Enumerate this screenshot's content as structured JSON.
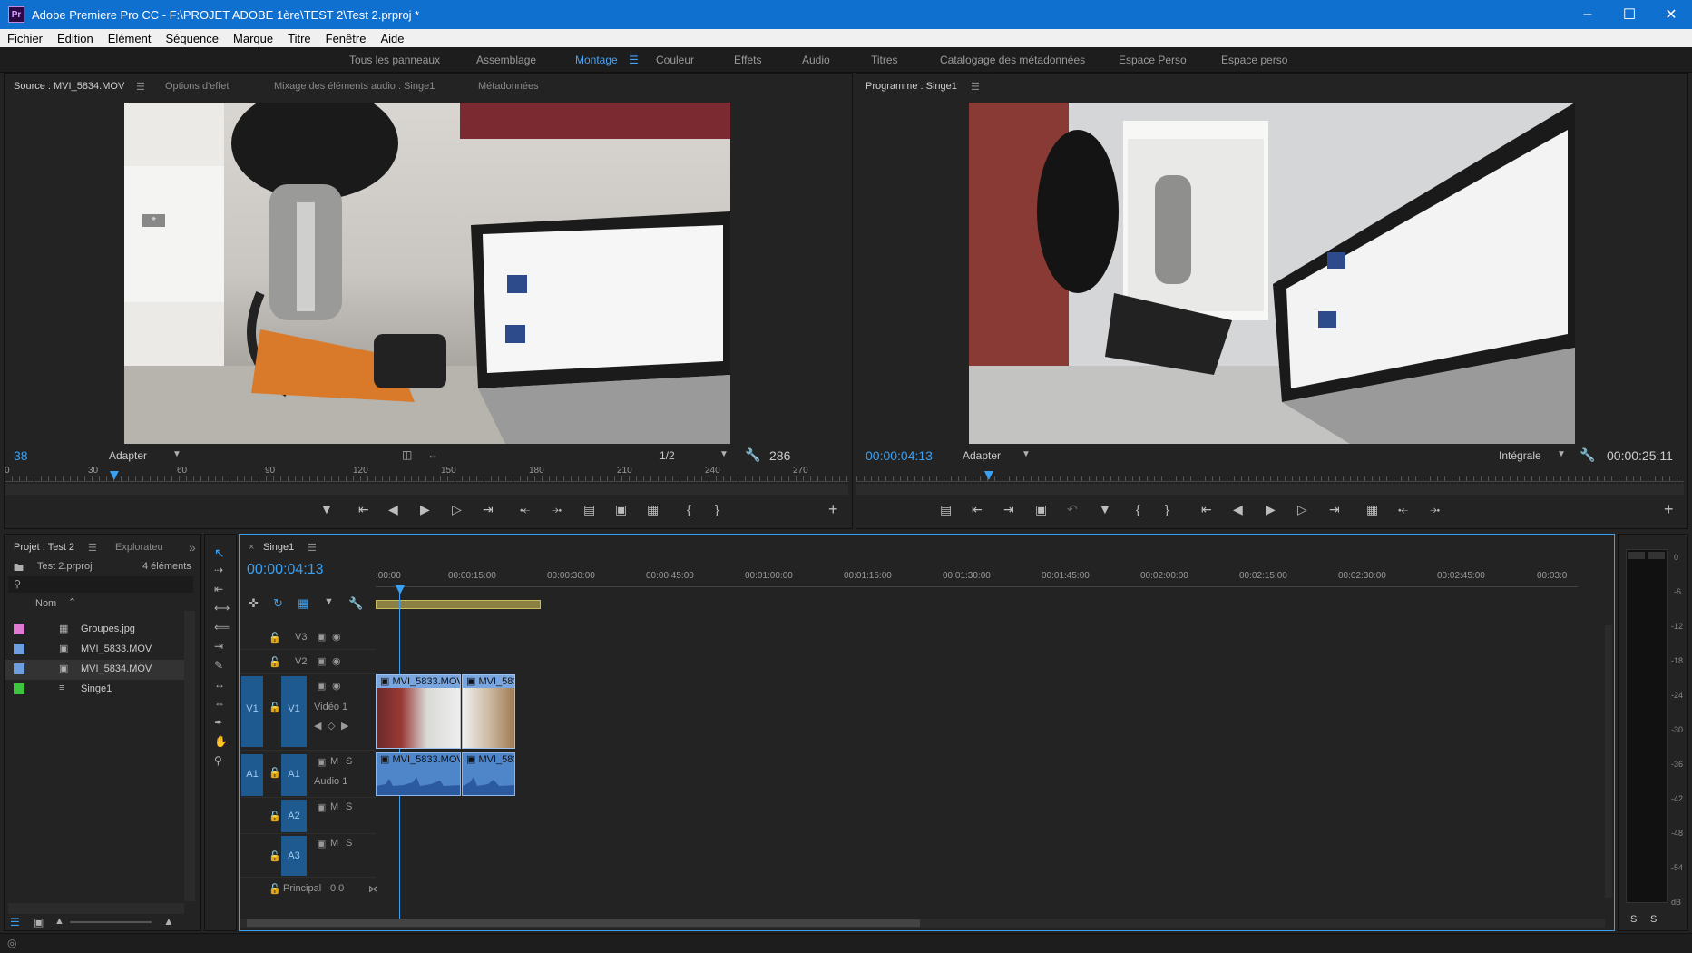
{
  "window": {
    "title": "Adobe Premiere Pro CC - F:\\PROJET ADOBE 1ère\\TEST 2\\Test 2.prproj *",
    "logo": "Pr"
  },
  "menu": [
    "Fichier",
    "Edition",
    "Elément",
    "Séquence",
    "Marque",
    "Titre",
    "Fenêtre",
    "Aide"
  ],
  "workspaces": [
    "Tous les panneaux",
    "Assemblage",
    "Montage",
    "Couleur",
    "Effets",
    "Audio",
    "Titres",
    "Catalogage des métadonnées",
    "Espace Perso",
    "Espace perso"
  ],
  "active_workspace": "Montage",
  "source": {
    "tabs": [
      "Source : MVI_5834.MOV",
      "Options d'effet",
      "Mixage des éléments audio : Singe1",
      "Métadonnées"
    ],
    "frame": "38",
    "fit": "Adapter",
    "quality": "1/2",
    "duration": "286",
    "ruler_ticks": [
      "0",
      "30",
      "60",
      "90",
      "120",
      "150",
      "180",
      "210",
      "240",
      "270"
    ],
    "playhead_fraction": 0.13
  },
  "program": {
    "tab": "Programme : Singe1",
    "timecode": "00:00:04:13",
    "fit": "Adapter",
    "quality": "Intégrale",
    "duration": "00:00:25:11",
    "playhead_fraction": 0.16
  },
  "project": {
    "tabs": [
      "Projet : Test 2",
      "Explorateu"
    ],
    "file": "Test 2.prproj",
    "count": "4 éléments",
    "column": "Nom",
    "items": [
      {
        "name": "Groupes.jpg",
        "color": "#e07ad0"
      },
      {
        "name": "MVI_5833.MOV",
        "color": "#6e9ee0"
      },
      {
        "name": "MVI_5834.MOV",
        "color": "#6e9ee0"
      },
      {
        "name": "Singe1",
        "color": "#3ec43e"
      }
    ]
  },
  "timeline": {
    "tab": "Singe1",
    "timecode": "00:00:04:13",
    "ruler": [
      ":00:00",
      "00:00:15:00",
      "00:00:30:00",
      "00:00:45:00",
      "00:01:00:00",
      "00:01:15:00",
      "00:01:30:00",
      "00:01:45:00",
      "00:02:00:00",
      "00:02:15:00",
      "00:02:30:00",
      "00:02:45:00",
      "00:03:0"
    ],
    "video_tracks": [
      {
        "src": "",
        "name": "V3",
        "label": ""
      },
      {
        "src": "",
        "name": "V2",
        "label": ""
      },
      {
        "src": "V1",
        "name": "V1",
        "label": "Vidéo 1"
      }
    ],
    "audio_tracks": [
      {
        "src": "A1",
        "name": "A1",
        "label": "Audio 1"
      },
      {
        "src": "",
        "name": "A2",
        "label": ""
      },
      {
        "src": "",
        "name": "A3",
        "label": ""
      }
    ],
    "master": {
      "label": "Principal",
      "value": "0.0"
    },
    "clips": [
      "MVI_5833.MOV",
      "MVI_583"
    ],
    "track_mute": "M",
    "track_solo": "S"
  },
  "meter": {
    "scale": [
      "0",
      "-6",
      "-12",
      "-18",
      "-24",
      "-30",
      "-36",
      "-42",
      "-48",
      "-54",
      "dB"
    ],
    "solo": [
      "S",
      "S"
    ]
  },
  "colors": {
    "accent": "#3aa0f2",
    "titlebar": "#0f70cf",
    "clip_video": "#5b8fd6",
    "clip_audio": "#4f85c9"
  }
}
